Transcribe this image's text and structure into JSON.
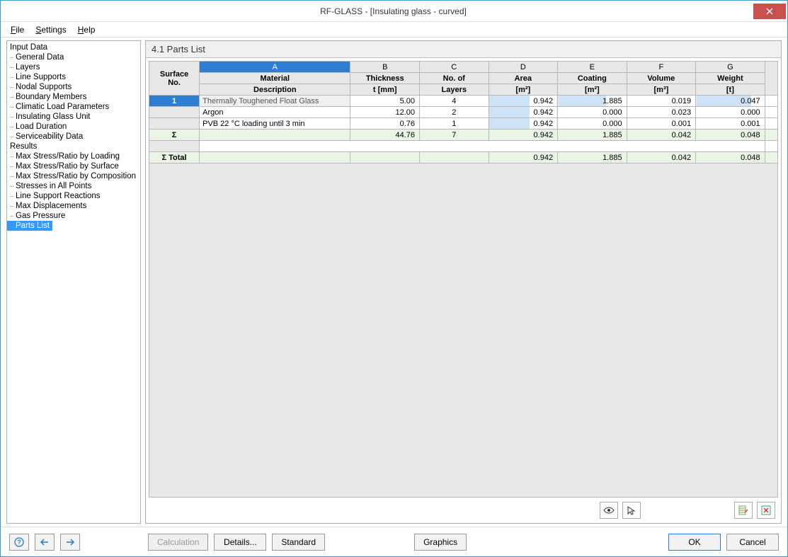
{
  "window": {
    "title": "RF-GLASS - [Insulating glass - curved]"
  },
  "menubar": {
    "file": "File",
    "settings": "Settings",
    "help": "Help"
  },
  "tree": {
    "input_data": "Input Data",
    "input_items": [
      "General Data",
      "Layers",
      "Line Supports",
      "Nodal Supports",
      "Boundary Members",
      "Climatic Load Parameters",
      "Insulating Glass Unit",
      "Load Duration",
      "Serviceability Data"
    ],
    "results": "Results",
    "results_items": [
      "Max Stress/Ratio by Loading",
      "Max Stress/Ratio by Surface",
      "Max Stress/Ratio by Composition",
      "Stresses in All Points",
      "Line Support Reactions",
      "Max Displacements",
      "Gas Pressure",
      "Parts List"
    ],
    "selected": "Parts List"
  },
  "panel": {
    "title": "4.1 Parts List"
  },
  "grid": {
    "row_header_top": "Surface",
    "row_header_bottom": "No.",
    "col_letters": [
      "A",
      "B",
      "C",
      "D",
      "E",
      "F",
      "G"
    ],
    "col_heads_top": [
      "Material",
      "Thickness",
      "No. of",
      "Area",
      "Coating",
      "Volume",
      "Weight"
    ],
    "col_heads_bottom": [
      "Description",
      "t [mm]",
      "Layers",
      "[m²]",
      "[m²]",
      "[m³]",
      "[t]"
    ],
    "rows": [
      {
        "no": "1",
        "desc": "Thermally Toughened Float Glass",
        "t": "5.00",
        "n": "4",
        "area": "0.942",
        "coat": "1.885",
        "vol": "0.019",
        "wt": "0.047",
        "d": true,
        "e": true,
        "g": true
      },
      {
        "no": "",
        "desc": "Argon",
        "t": "12.00",
        "n": "2",
        "area": "0.942",
        "coat": "0.000",
        "vol": "0.023",
        "wt": "0.000",
        "d": true,
        "e": false,
        "g": false
      },
      {
        "no": "",
        "desc": "PVB 22 °C loading until 3 min",
        "t": "0.76",
        "n": "1",
        "area": "0.942",
        "coat": "0.000",
        "vol": "0.001",
        "wt": "0.001",
        "d": true,
        "e": false,
        "g": false
      }
    ],
    "sigma_label": "Σ",
    "sigma": {
      "t": "44.76",
      "n": "7",
      "area": "0.942",
      "coat": "1.885",
      "vol": "0.042",
      "wt": "0.048"
    },
    "total_label": "Σ Total",
    "total": {
      "area": "0.942",
      "coat": "1.885",
      "vol": "0.042",
      "wt": "0.048"
    }
  },
  "footer": {
    "calculation": "Calculation",
    "details": "Details...",
    "standard": "Standard",
    "graphics": "Graphics",
    "ok": "OK",
    "cancel": "Cancel"
  }
}
